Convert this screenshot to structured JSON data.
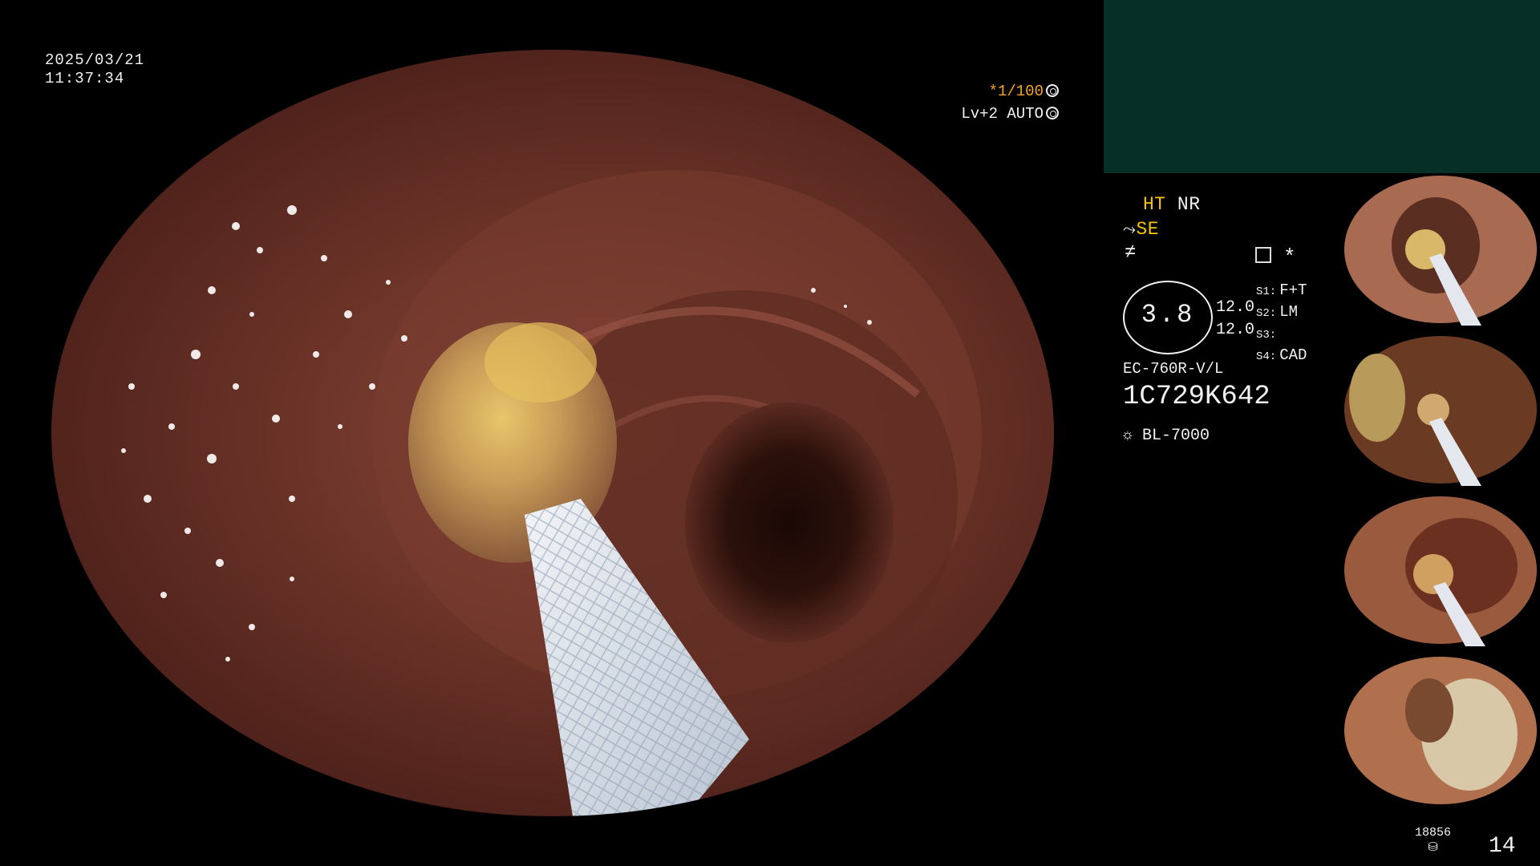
{
  "overlay": {
    "date": "2025/03/21",
    "time": "11:37:34",
    "shutter": "*1/100",
    "level": "Lv+2 AUTO"
  },
  "modes": {
    "ht": "HT",
    "nr": "NR",
    "se": "SE"
  },
  "gauge": {
    "value": "3.8",
    "upper": "12.0",
    "lower": "12.0"
  },
  "settings": [
    {
      "label": "S1:",
      "value": "F+T"
    },
    {
      "label": "S2:",
      "value": "LM"
    },
    {
      "label": "S3:",
      "value": ""
    },
    {
      "label": "S4:",
      "value": "CAD"
    }
  ],
  "scope": {
    "model": "EC-760R-V/L",
    "serial": "1C729K642",
    "light_source": "BL-7000"
  },
  "footer": {
    "capture_count": "18856",
    "page": "14"
  },
  "icons": {
    "shutter": "aperture-icon",
    "auto": "auto-iris-icon",
    "light": "sun-icon",
    "menu": "menu-icon",
    "storage": "disk-icon"
  },
  "colors": {
    "accent_yellow": "#f5c400",
    "accent_orange": "#f5a623",
    "panel_green": "#062f25"
  }
}
